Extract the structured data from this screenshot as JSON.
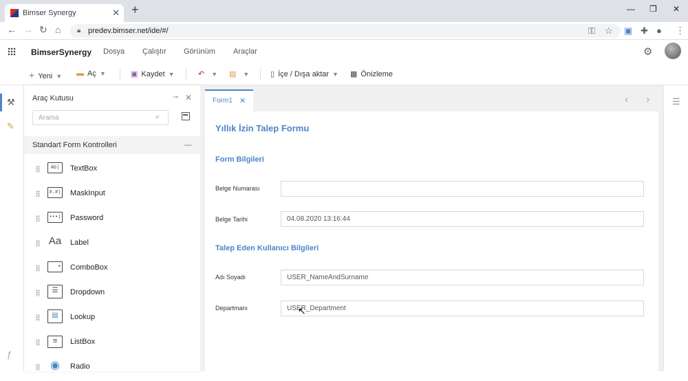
{
  "browser": {
    "tab_title": "Bimser Synergy",
    "url": "predev.bimser.net/ide/#/",
    "new_tab": "+",
    "tab_close": "✕"
  },
  "app": {
    "brand": "BimserSynergy",
    "menu": [
      "Dosya",
      "Çalıştır",
      "Görünüm",
      "Araçlar"
    ]
  },
  "toolbar": {
    "new_label": "Yeni",
    "open_label": "Aç",
    "save_label": "Kaydet",
    "import_export_label": "İçe / Dışa aktar",
    "preview_label": "Önizleme"
  },
  "toolbox": {
    "title": "Araç Kutusu",
    "search_placeholder": "Arama",
    "section_title": "Standart Form Kontrolleri",
    "controls": [
      {
        "label": "TextBox",
        "icon": "Ab|"
      },
      {
        "label": "MaskInput",
        "icon": "#.#|"
      },
      {
        "label": "Password",
        "icon": "•••|"
      },
      {
        "label": "Label",
        "icon": "Aa"
      },
      {
        "label": "ComboBox",
        "icon": "▾"
      },
      {
        "label": "Dropdown",
        "icon": "☰"
      },
      {
        "label": "Lookup",
        "icon": "▤"
      },
      {
        "label": "ListBox",
        "icon": "≡"
      },
      {
        "label": "Radio",
        "icon": "◉"
      }
    ]
  },
  "editor": {
    "tab_label": "Form1",
    "form_title": "Yıllık İzin Talep Formu",
    "section1": "Form Bilgileri",
    "section2": "Talep Eden Kullanıcı Bilgileri",
    "fields": [
      {
        "label": "Belge Numarası",
        "value": ""
      },
      {
        "label": "Belge Tarihi",
        "value": "04.08.2020 13:16:44"
      },
      {
        "label": "Adı Soyadı",
        "value": "USER_NameAndSurname"
      },
      {
        "label": "Departmanı",
        "value": "USER_Department"
      }
    ]
  },
  "colors": {
    "accent": "#4a86c8",
    "tab_strip": "#dee1e6"
  }
}
